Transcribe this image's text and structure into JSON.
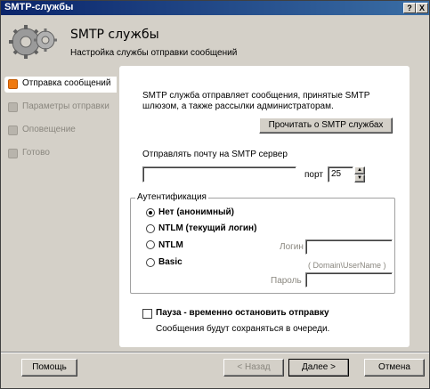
{
  "window": {
    "title": "SMTP-службы",
    "help_btn": "?",
    "close_btn": "X"
  },
  "header": {
    "title": "SMTP службы",
    "subtitle": "Настройка службы отправки сообщений"
  },
  "sidebar": {
    "items": [
      {
        "label": "Отправка сообщений",
        "active": true
      },
      {
        "label": "Параметры отправки",
        "active": false
      },
      {
        "label": "Оповещение",
        "active": false
      },
      {
        "label": "Готово",
        "active": false
      }
    ]
  },
  "main": {
    "description": "SMTP служба отправляет сообщения, принятые SMTP шлюзом, а также рассылки администраторам.",
    "read_about_button": "Прочитать о SMTP службах",
    "server_label": "Отправлять почту на SMTP сервер",
    "server_value": "",
    "port_label": "порт",
    "port_value": "25",
    "auth": {
      "legend": "Аутентификация",
      "options": [
        {
          "label": "Нет (анонимный)",
          "selected": true
        },
        {
          "label": "NTLM (текущий логин)",
          "selected": false
        },
        {
          "label": "NTLM",
          "selected": false
        },
        {
          "label": "Basic",
          "selected": false
        }
      ],
      "login_label": "Логин",
      "login_value": "",
      "login_hint": "( Domain\\UserName )",
      "password_label": "Пароль",
      "password_value": ""
    },
    "pause_label": "Пауза - временно остановить отправку",
    "pause_checked": false,
    "pause_note": "Сообщения будут сохраняться в очереди."
  },
  "footer": {
    "help": "Помощь",
    "back": "< Назад",
    "next": "Далее >",
    "cancel": "Отмена"
  },
  "colors": {
    "titlebar": "#0a246a",
    "active_marker": "#f07a10",
    "window_bg": "#d4d0c8"
  }
}
